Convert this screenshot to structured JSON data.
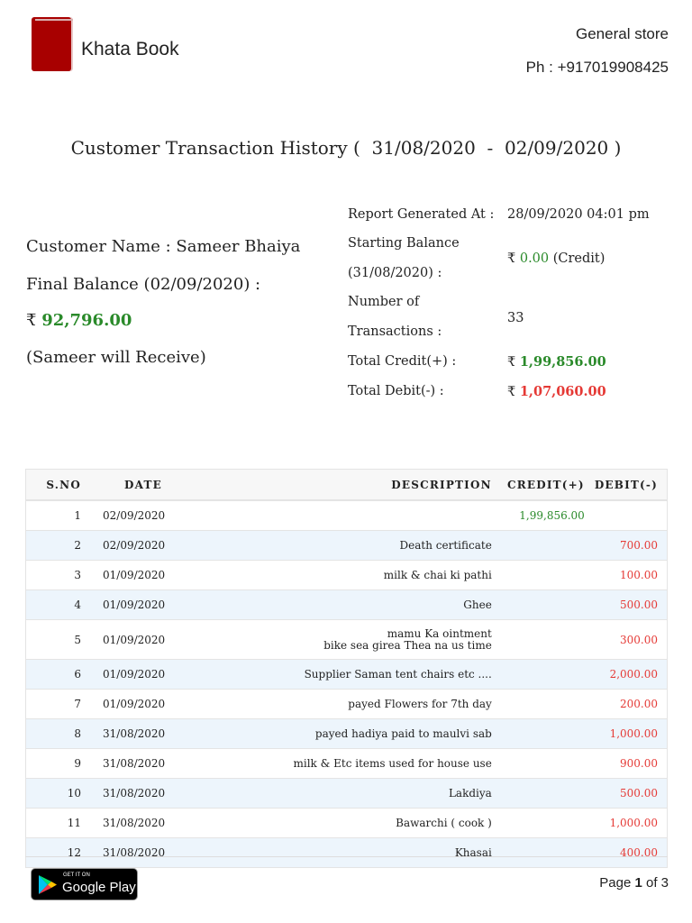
{
  "header": {
    "app_name": "Khata Book",
    "store": "General store",
    "phone": "Ph : +917019908425"
  },
  "title": "Customer Transaction History (  31/08/2020  -  02/09/2020 )",
  "customer": {
    "name": "Customer Name : Sameer Bhaiya",
    "final_balance_label": "Final Balance (02/09/2020) :",
    "currency": "₹",
    "final_balance": "92,796.00",
    "note": "(Sameer will Receive)"
  },
  "report": {
    "generated_label": "Report Generated At :",
    "generated_value": "28/09/2020 04:01 pm",
    "starting_label_1": "Starting Balance",
    "starting_label_2": "(31/08/2020) :",
    "starting_value": "0.00",
    "starting_type": "(Credit)",
    "txn_label_1": "Number of",
    "txn_label_2": "Transactions :",
    "txn_value": "33",
    "credit_label": "Total Credit(+) :",
    "credit_value": "1,99,856.00",
    "debit_label": "Total Debit(-) :",
    "debit_value": "1,07,060.00"
  },
  "table": {
    "headers": [
      "S.NO",
      "DATE",
      "DESCRIPTION",
      "CREDIT(+)",
      "DEBIT(-)"
    ],
    "rows": [
      {
        "sno": "1",
        "date": "02/09/2020",
        "desc": "",
        "credit": "1,99,856.00",
        "debit": ""
      },
      {
        "sno": "2",
        "date": "02/09/2020",
        "desc": "Death certificate",
        "credit": "",
        "debit": "700.00"
      },
      {
        "sno": "3",
        "date": "01/09/2020",
        "desc": "milk & chai ki pathi",
        "credit": "",
        "debit": "100.00"
      },
      {
        "sno": "4",
        "date": "01/09/2020",
        "desc": "Ghee",
        "credit": "",
        "debit": "500.00"
      },
      {
        "sno": "5",
        "date": "01/09/2020",
        "desc": "mamu Ka ointment",
        "desc2": "bike sea girea Thea na us time",
        "credit": "",
        "debit": "300.00"
      },
      {
        "sno": "6",
        "date": "01/09/2020",
        "desc": "Supplier Saman tent chairs etc ....",
        "credit": "",
        "debit": "2,000.00"
      },
      {
        "sno": "7",
        "date": "01/09/2020",
        "desc": "payed Flowers for 7th day",
        "credit": "",
        "debit": "200.00"
      },
      {
        "sno": "8",
        "date": "31/08/2020",
        "desc": "payed hadiya paid to maulvi sab",
        "credit": "",
        "debit": "1,000.00"
      },
      {
        "sno": "9",
        "date": "31/08/2020",
        "desc": "milk & Etc items used for house use",
        "credit": "",
        "debit": "900.00"
      },
      {
        "sno": "10",
        "date": "31/08/2020",
        "desc": "Lakdiya",
        "credit": "",
        "debit": "500.00"
      },
      {
        "sno": "11",
        "date": "31/08/2020",
        "desc": "Bawarchi ( cook )",
        "credit": "",
        "debit": "1,000.00"
      },
      {
        "sno": "12",
        "date": "31/08/2020",
        "desc": "Khasai",
        "credit": "",
        "debit": "400.00"
      }
    ]
  },
  "footer": {
    "badge_small": "GET IT ON",
    "badge_big": "Google Play",
    "page_prefix": "Page ",
    "page_current": "1",
    "page_suffix": " of 3"
  }
}
